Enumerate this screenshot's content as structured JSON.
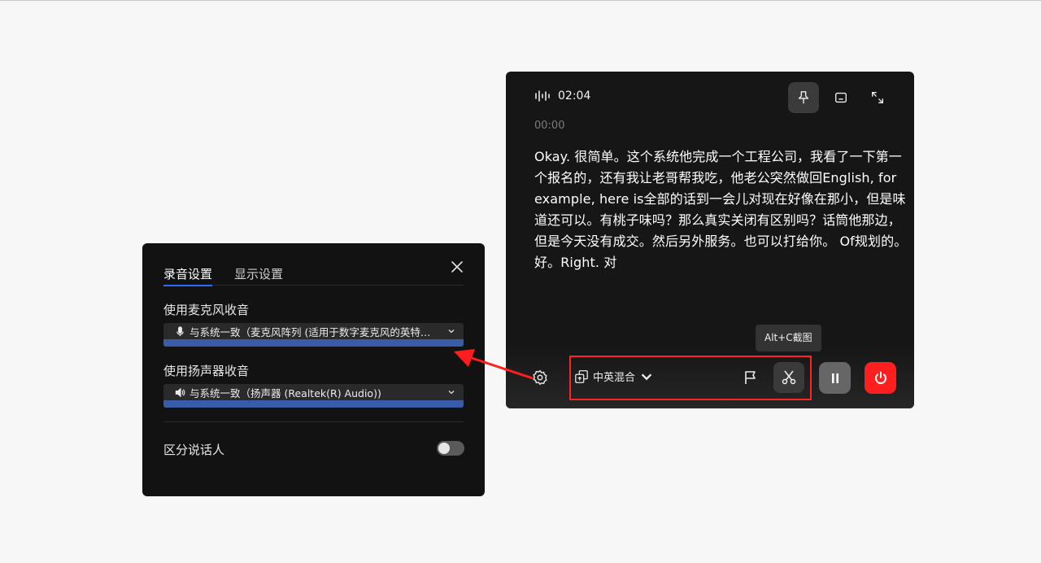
{
  "recorder": {
    "timer": "02:04",
    "timestamp": "00:00",
    "transcript": "Okay. 很简单。这个系统他完成一个工程公司，我看了一下第一个报名的，还有我让老哥帮我吃，他老公突然做回English, for example, here is全部的话到一会儿对现在好像在那小，但是味道还可以。有桃子味吗？那么真实关闭有区别吗？话筒他那边，但是今天没有成交。然后另外服务。也可以打给你。 Of规划的。好。Right. 对",
    "language_label": "中英混合",
    "tooltip": "Alt+C截图",
    "colors": {
      "power": "#ff1f1f",
      "highlight": "#ff2424"
    }
  },
  "settings": {
    "tabs": [
      "录音设置",
      "显示设置"
    ],
    "mic_label": "使用麦克风收音",
    "mic_value": "与系统一致（麦克风阵列 (适用于数字麦克风的英特…",
    "speaker_label": "使用扬声器收音",
    "speaker_value": "与系统一致（扬声器 (Realtek(R) Audio))",
    "speaker_diarization_label": "区分说话人",
    "speaker_diarization_on": false,
    "colors": {
      "accent": "#2f6bff",
      "select_bar": "#3a5ca8"
    }
  }
}
